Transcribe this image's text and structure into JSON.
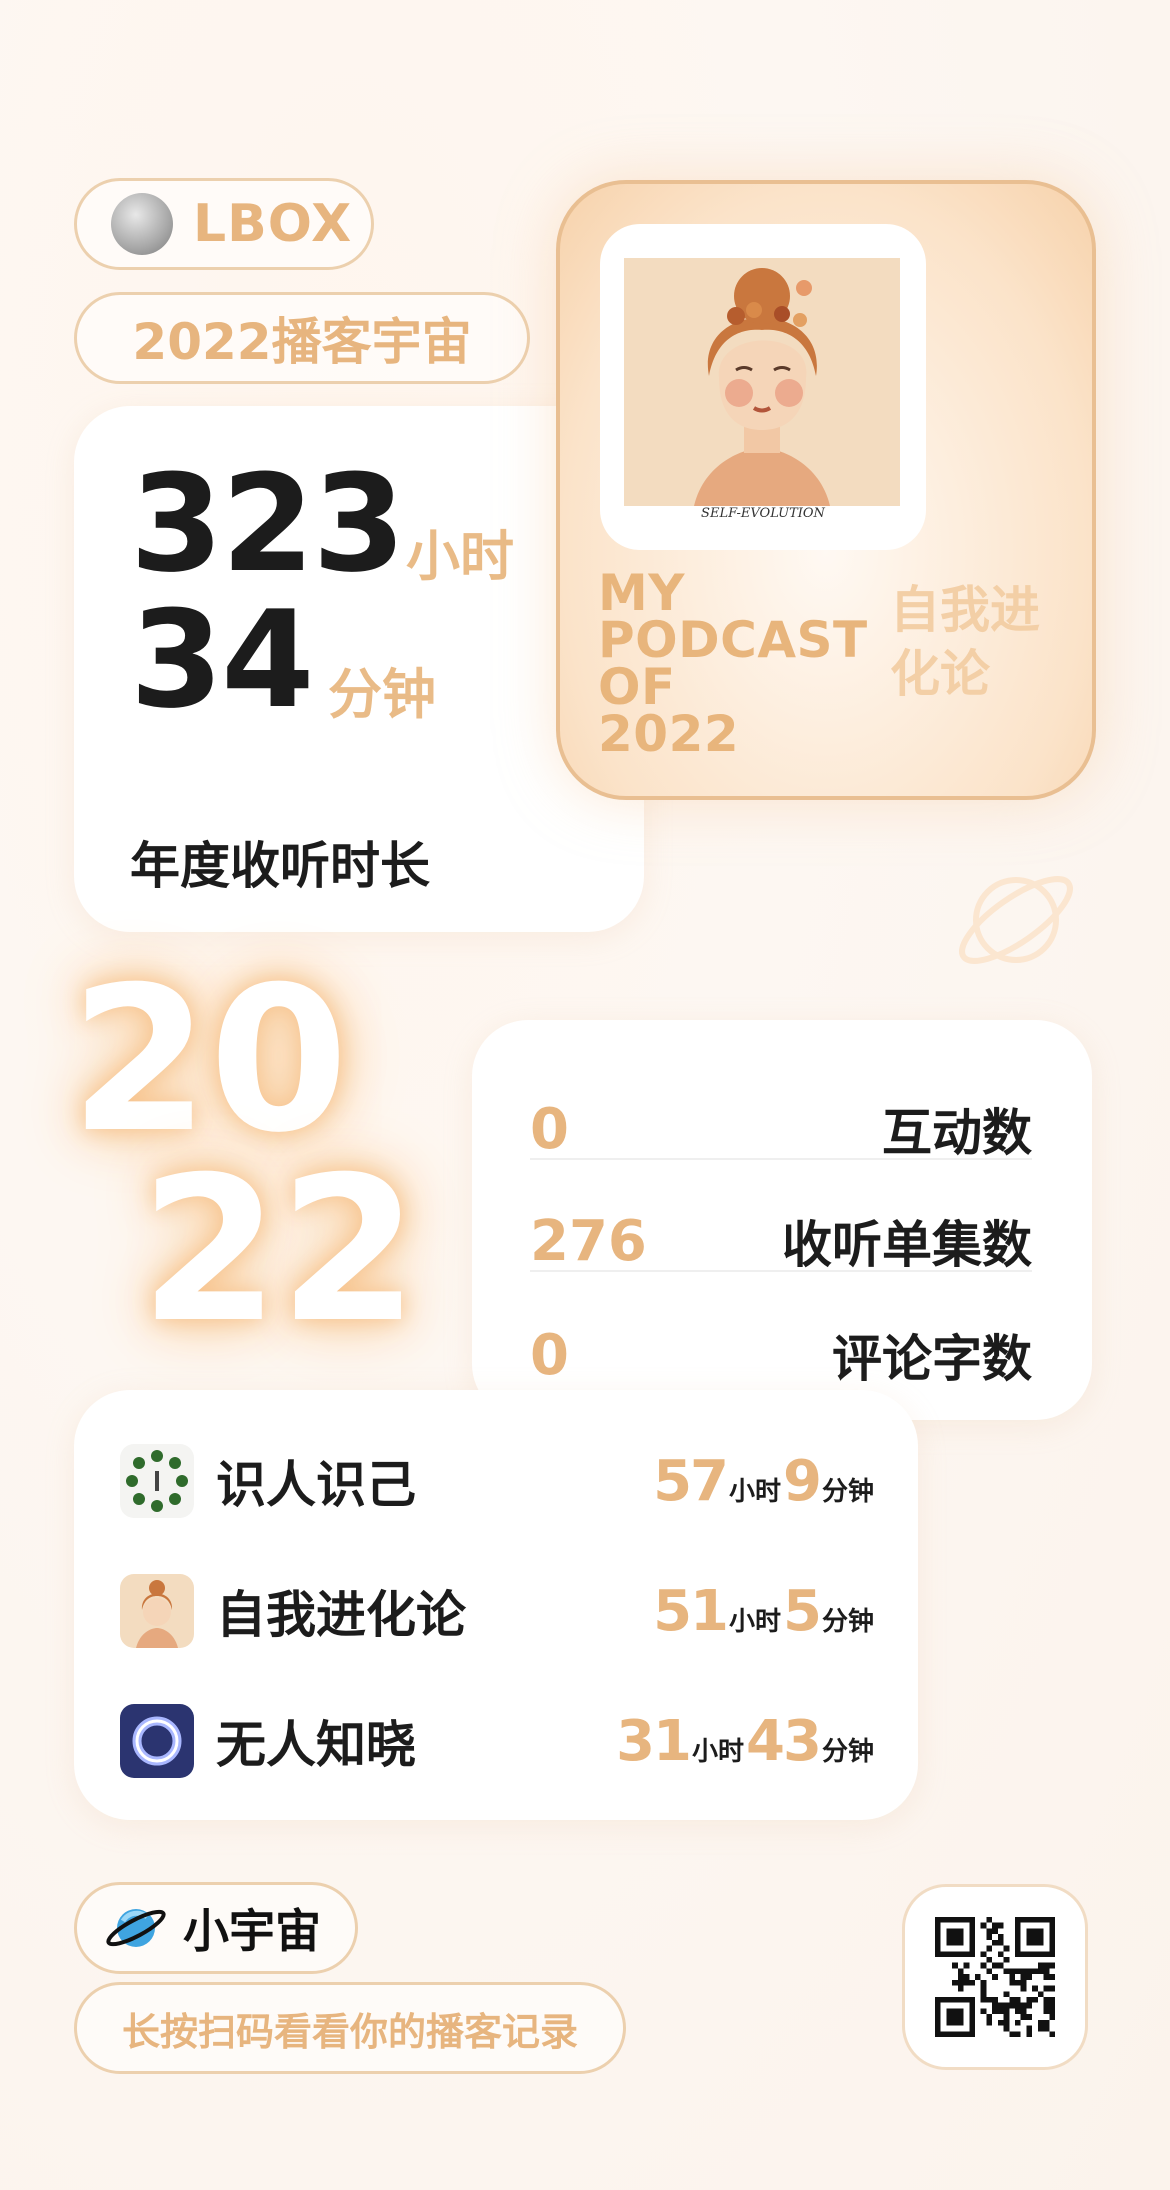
{
  "user": {
    "name": "LBOX"
  },
  "headline": "2022播客宇宙",
  "listening": {
    "hours": "323",
    "hours_unit": "小时",
    "minutes": "34",
    "minutes_unit": "分钟",
    "label": "年度收听时长"
  },
  "featured_podcast": {
    "cover_caption": "SELF-EVOLUTION",
    "caption": "MY\nPODCAST\nOF\n2022",
    "name": "自我进化论"
  },
  "year_graphic": {
    "line1": "20",
    "line2": "22"
  },
  "stats": [
    {
      "value": "0",
      "label": "互动数"
    },
    {
      "value": "276",
      "label": "收听单集数"
    },
    {
      "value": "0",
      "label": "评论字数"
    }
  ],
  "top_podcasts": [
    {
      "name": "识人识己",
      "hours": "57",
      "hours_unit": "小时",
      "minutes": "9",
      "minutes_unit": "分钟",
      "icon": "wreath-cover-icon"
    },
    {
      "name": "自我进化论",
      "hours": "51",
      "hours_unit": "小时",
      "minutes": "5",
      "minutes_unit": "分钟",
      "icon": "portrait-cover-icon"
    },
    {
      "name": "无人知晓",
      "hours": "31",
      "hours_unit": "小时",
      "minutes": "43",
      "minutes_unit": "分钟",
      "icon": "ring-cover-icon"
    }
  ],
  "brand": {
    "name": "小宇宙",
    "icon": "planet-logo-icon"
  },
  "hint": "长按扫码看看你的播客记录",
  "colors": {
    "accent": "#e7b57f",
    "text": "#1c1c1c",
    "card": "#ffffff",
    "ring_icon_bg": "#2b3470"
  }
}
